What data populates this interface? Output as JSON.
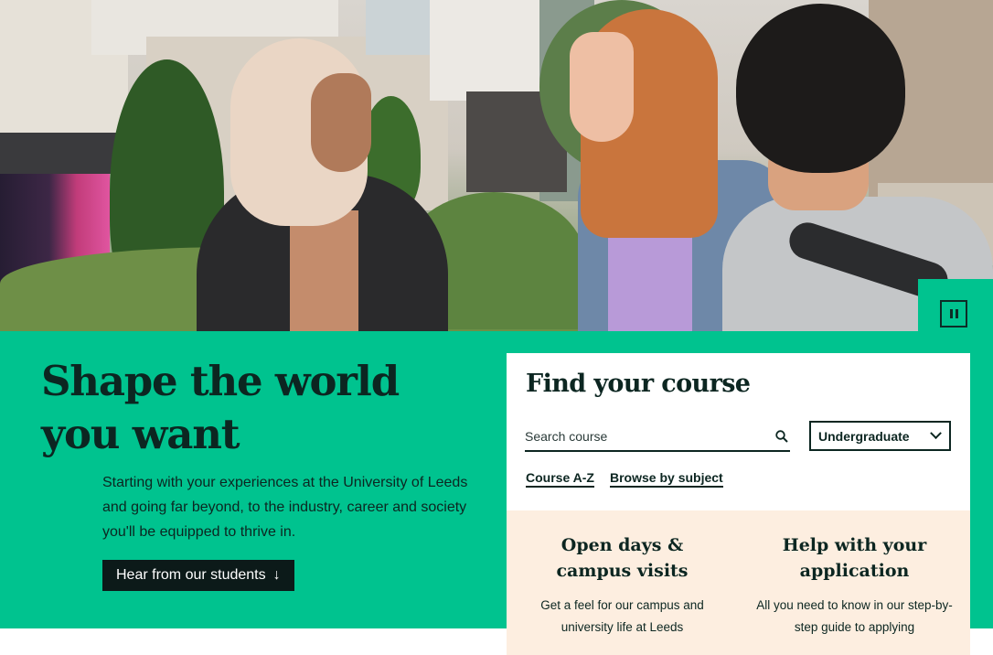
{
  "hero": {
    "image_alt": "Three students chatting outdoors on campus",
    "pause_label": "Pause"
  },
  "headline": {
    "line1": "Shape the world",
    "line2": "you want"
  },
  "intro": "Starting with your experiences at the University of Leeds and going far beyond, to the industry, career and society you'll be equipped to thrive in.",
  "cta": {
    "label": "Hear from our students",
    "icon": "arrow-down-icon"
  },
  "finder": {
    "title": "Find your course",
    "search_placeholder": "Search course",
    "search_icon": "search-icon",
    "level_selected": "Undergraduate",
    "links": [
      "Course A-Z",
      "Browse by subject"
    ]
  },
  "info": [
    {
      "title": "Open days & campus visits",
      "text": "Get a feel for our campus and university life at Leeds"
    },
    {
      "title": "Help with your application",
      "text": "All you need to know in our step-by-step guide to applying"
    }
  ],
  "colors": {
    "brand_green": "#00c38f",
    "dark_text": "#0c2621",
    "cream_panel": "#fdeee0",
    "cta_bg": "#0c1a19"
  }
}
